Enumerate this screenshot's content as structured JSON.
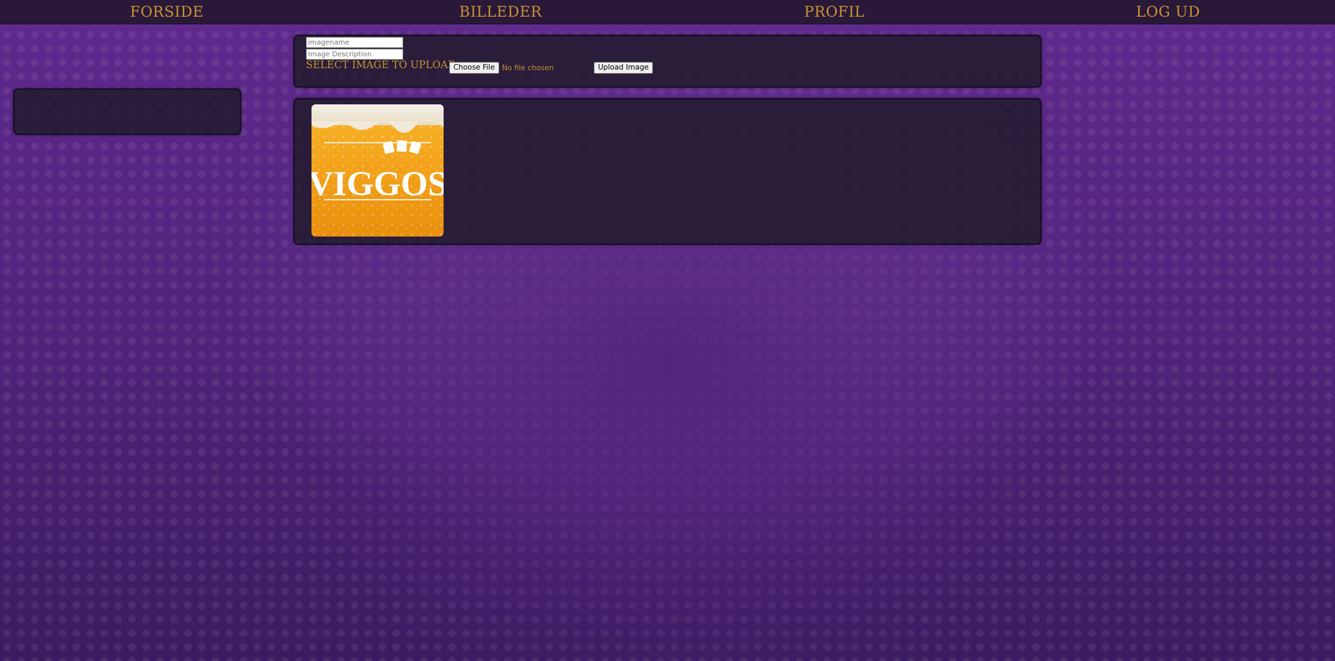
{
  "nav": {
    "items": [
      {
        "label": "Forside"
      },
      {
        "label": "Billeder"
      },
      {
        "label": "Profil"
      },
      {
        "label": "Log ud"
      }
    ]
  },
  "upload": {
    "name_placeholder": "imagename",
    "description_placeholder": "Image Description",
    "select_label": "Select image to upload:",
    "choose_file_label": "Choose File",
    "file_status": "No file chosen",
    "submit_label": "Upload Image"
  },
  "gallery": {
    "images": [
      {
        "logo_text": "VIGGOS",
        "icon": "beer-mugs-icon"
      }
    ]
  },
  "colors": {
    "accent": "#c79432",
    "nav_bg": "#2a1839",
    "panel_bg": "#261c34",
    "page_bg": "#552680"
  }
}
